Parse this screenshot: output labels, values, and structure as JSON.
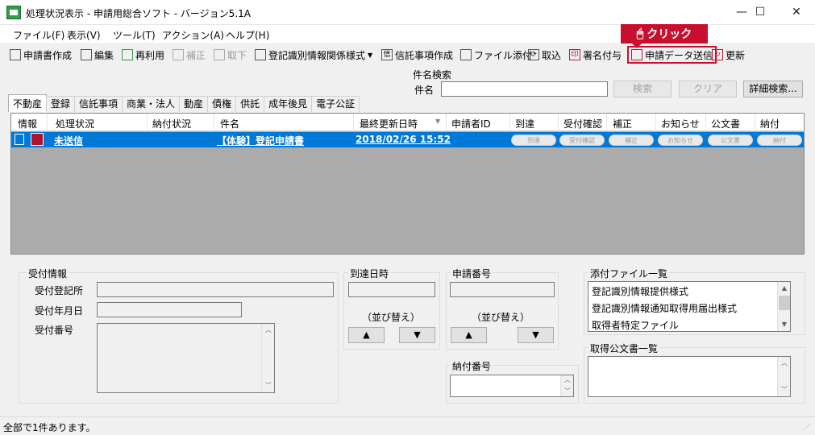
{
  "window": {
    "title": "処理状況表示 - 申請用総合ソフト - バージョン5.1A",
    "minimize": "—",
    "maximize": "☐",
    "close": "✕"
  },
  "menu": [
    "ファイル(F)",
    "表示(V)",
    "ツール(T)",
    "アクション(A)",
    "ヘルプ(H)"
  ],
  "toolbar": {
    "create_application": "申請書作成",
    "edit": "編集",
    "reuse": "再利用",
    "amend": "補正",
    "withdraw": "取下",
    "registration_form": "登記識別情報関係様式",
    "trust_item_create": "信託事項作成",
    "attach_file": "ファイル添付",
    "import": "取込",
    "sign": "署名付与",
    "submit": "申請データ送信",
    "refresh": "更新",
    "callout": "クリック"
  },
  "search": {
    "legend": "件名検索",
    "label": "件名",
    "value": "",
    "search_button": "検索",
    "clear_button": "クリア",
    "advanced_button": "詳細検索..."
  },
  "tabs": [
    "不動産",
    "登録",
    "信託事項",
    "商業・法人",
    "動産",
    "債権",
    "供託",
    "成年後見",
    "電子公証"
  ],
  "grid": {
    "columns": [
      "情報",
      "処理状況",
      "納付状況",
      "件名",
      "最終更新日時",
      "申請者ID",
      "到達",
      "受付確認",
      "補正",
      "お知らせ",
      "公文書",
      "納付"
    ],
    "rows": [
      {
        "status": "未送信",
        "payment": "",
        "subject": "【体験】登記申請書",
        "updated": "2018/02/26 15:52",
        "applicant_id": "",
        "pills": [
          "到達",
          "受付確認",
          "補正",
          "お知らせ",
          "公文書",
          "納付"
        ]
      }
    ]
  },
  "reception": {
    "legend": "受付情報",
    "office_label": "受付登記所",
    "date_label": "受付年月日",
    "number_label": "受付番号"
  },
  "arrival": {
    "legend": "到達日時",
    "sort_label": "（並び替え）",
    "up": "▲",
    "down": "▼"
  },
  "app_number": {
    "legend": "申請番号",
    "sort_label": "（並び替え）",
    "up": "▲",
    "down": "▼"
  },
  "payment_number": {
    "legend": "納付番号"
  },
  "attachments": {
    "legend": "添付ファイル一覧",
    "items": [
      "登記識別情報提供様式",
      "登記識別情報通知取得用届出様式",
      "取得者特定ファイル"
    ]
  },
  "official_docs": {
    "legend": "取得公文書一覧"
  },
  "status_bar": {
    "text": "全部で1件あります。"
  },
  "colors": {
    "selection": "#0078d7",
    "callout": "#c8102e",
    "grid_bg": "#ababab"
  }
}
